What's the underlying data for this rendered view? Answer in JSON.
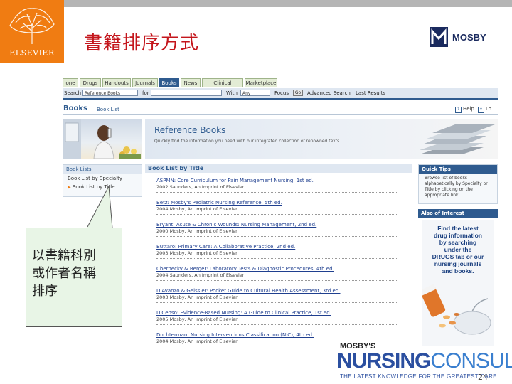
{
  "slide": {
    "title": "書籍排序方式",
    "brand_logo": "ELSEVIER",
    "partner_logo": "MOSBY",
    "page_number": "24"
  },
  "screenshot": {
    "tabs": [
      "one",
      "Drugs",
      "Handouts",
      "Journals",
      "Books",
      "News",
      "Clinical Updates",
      "Marketplace"
    ],
    "active_tab": "Books",
    "search": {
      "label": "Search",
      "select_value": "Reference Books",
      "for_label": "for",
      "with_label": "With",
      "with_value": "Any",
      "focus_label": "Focus",
      "go_label": "Go",
      "advanced": "Advanced Search",
      "last": "Last Results"
    },
    "books_header": "Books",
    "books_link": "Book List",
    "help": "Help",
    "logout": "Lo",
    "banner_title": "Reference Books",
    "banner_subtitle": "Quickly find the information you need with our integrated collection of renowned texts",
    "booklists": {
      "title": "Book Lists",
      "items": [
        "Book List by Specialty",
        "Book List by Title"
      ]
    },
    "list_title": "Book List by Title",
    "entries": [
      {
        "title": "ASPMN: Core Curriculum for Pain Management Nursing, 1st ed.",
        "publisher": "2002 Saunders, An Imprint of Elsevier"
      },
      {
        "title": "Betz: Mosby's Pediatric Nursing Reference, 5th ed.",
        "publisher": "2004 Mosby, An Imprint of Elsevier"
      },
      {
        "title": "Bryant: Acute & Chronic Wounds: Nursing Management, 2nd ed.",
        "publisher": "2000 Mosby, An Imprint of Elsevier"
      },
      {
        "title": "Buttaro: Primary Care: A Collaborative Practice, 2nd ed.",
        "publisher": "2003 Mosby, An Imprint of Elsevier"
      },
      {
        "title": "Chernecky & Berger: Laboratory Tests & Diagnostic Procedures, 4th ed.",
        "publisher": "2004 Saunders, An Imprint of Elsevier"
      },
      {
        "title": "D'Avanzo & Geissler: Pocket Guide to Cultural Health Assessment, 3rd ed.",
        "publisher": "2003 Mosby, An Imprint of Elsevier"
      },
      {
        "title": "DiCenso: Evidence-Based Nursing: A Guide to Clinical Practice, 1st ed.",
        "publisher": "2005 Mosby, An Imprint of Elsevier"
      },
      {
        "title": "Dochterman: Nursing Interventions Classification (NIC), 4th ed.",
        "publisher": "2004 Mosby, An Imprint of Elsevier"
      }
    ],
    "quick_tips": {
      "title": "Quick Tips",
      "text": "Browse list of books alphabetically by Specialty or Title by clicking on the appropriate link"
    },
    "also_title": "Also of Interest",
    "ad_text": [
      "Find the latest",
      "drug information",
      "by searching",
      "under the",
      "DRUGS tab or our",
      "nursing journals",
      "and books."
    ]
  },
  "callout": {
    "lines": [
      "以書籍科別",
      "或作者名稱",
      "排序"
    ]
  },
  "nursing_consult": {
    "mosbys": "MOSBY'S",
    "word_a": "NURSING",
    "word_b": "CONSULT",
    "tagline": "THE LATEST KNOWLEDGE FOR THE GREATEST CARE"
  },
  "colors": {
    "title_red": "#c4161c",
    "elsevier_orange": "#f07c12",
    "nav_blue": "#2f5b8f"
  }
}
